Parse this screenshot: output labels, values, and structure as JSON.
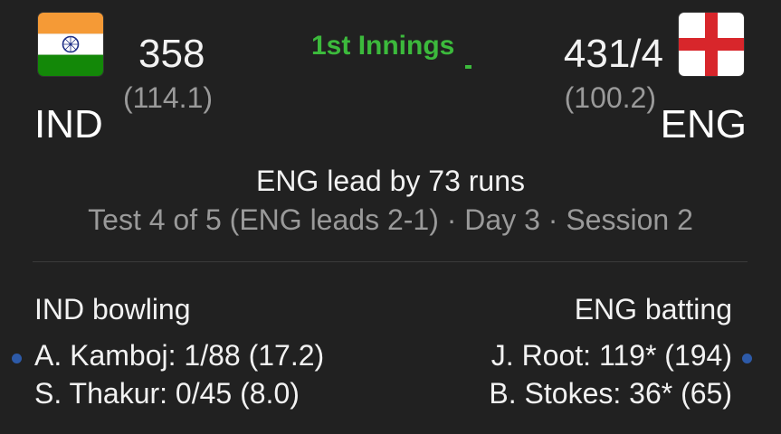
{
  "home": {
    "code": "IND",
    "score": "358",
    "overs": "(114.1)",
    "flag": "india-flag-icon"
  },
  "away": {
    "code": "ENG",
    "score": "431/4",
    "overs": "(100.2)",
    "flag": "england-flag-icon"
  },
  "innings_label": "1st Innings",
  "status": {
    "lead": "ENG lead by 73 runs",
    "series": "Test 4 of 5 (ENG leads 2-1) · Day 3 · Session 2"
  },
  "bowling": {
    "heading": "IND bowling",
    "players": [
      {
        "line": "A. Kamboj: 1/88 (17.2)",
        "active": true
      },
      {
        "line": "S. Thakur: 0/45 (8.0)",
        "active": false
      }
    ]
  },
  "batting": {
    "heading": "ENG batting",
    "players": [
      {
        "line": "J. Root: 119* (194)",
        "active": true
      },
      {
        "line": "B. Stokes: 36* (65)",
        "active": false
      }
    ]
  },
  "colors": {
    "background": "#212121",
    "innings_green": "#3cba3c",
    "active_dot": "#2d5aa8",
    "muted_text": "#9a9a9a"
  }
}
